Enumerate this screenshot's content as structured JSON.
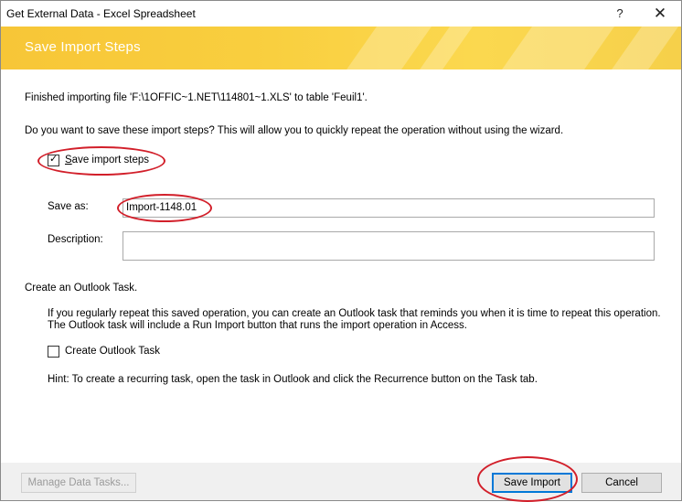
{
  "window": {
    "title": "Get External Data - Excel Spreadsheet",
    "help_glyph": "?",
    "close_glyph": "✕"
  },
  "banner": {
    "title": "Save Import Steps"
  },
  "main": {
    "finished_text": "Finished importing file 'F:\\1OFFIC~1.NET\\114801~1.XLS' to table 'Feuil1'.",
    "question_text": "Do you want to save these import steps? This will allow you to quickly repeat the operation without using the wizard.",
    "save_steps_checkbox": {
      "label": "Save import steps",
      "checked": true,
      "checkmark": "✓"
    },
    "save_as": {
      "label": "Save as:",
      "value": "Import-1148.01"
    },
    "description": {
      "label": "Description:",
      "value": ""
    },
    "outlook_section_title": "Create an Outlook Task.",
    "outlook_info_line1": "If you regularly repeat this saved operation, you can create an Outlook task that reminds you when it is time to repeat this operation.",
    "outlook_info_line2": "The Outlook task will include a Run Import button that runs the import operation in Access.",
    "create_outlook_task_checkbox": {
      "label": "Create Outlook Task",
      "checked": false
    },
    "hint_text": "Hint: To create a recurring task, open the task in Outlook and click the Recurrence button on the Task tab."
  },
  "footer": {
    "manage_label": "Manage Data Tasks...",
    "save_import_label": "Save Import",
    "cancel_label": "Cancel"
  },
  "colors": {
    "banner": "#f9cf3f",
    "annotation_ellipse": "#d21f2a",
    "default_button_border": "#0078d7"
  }
}
